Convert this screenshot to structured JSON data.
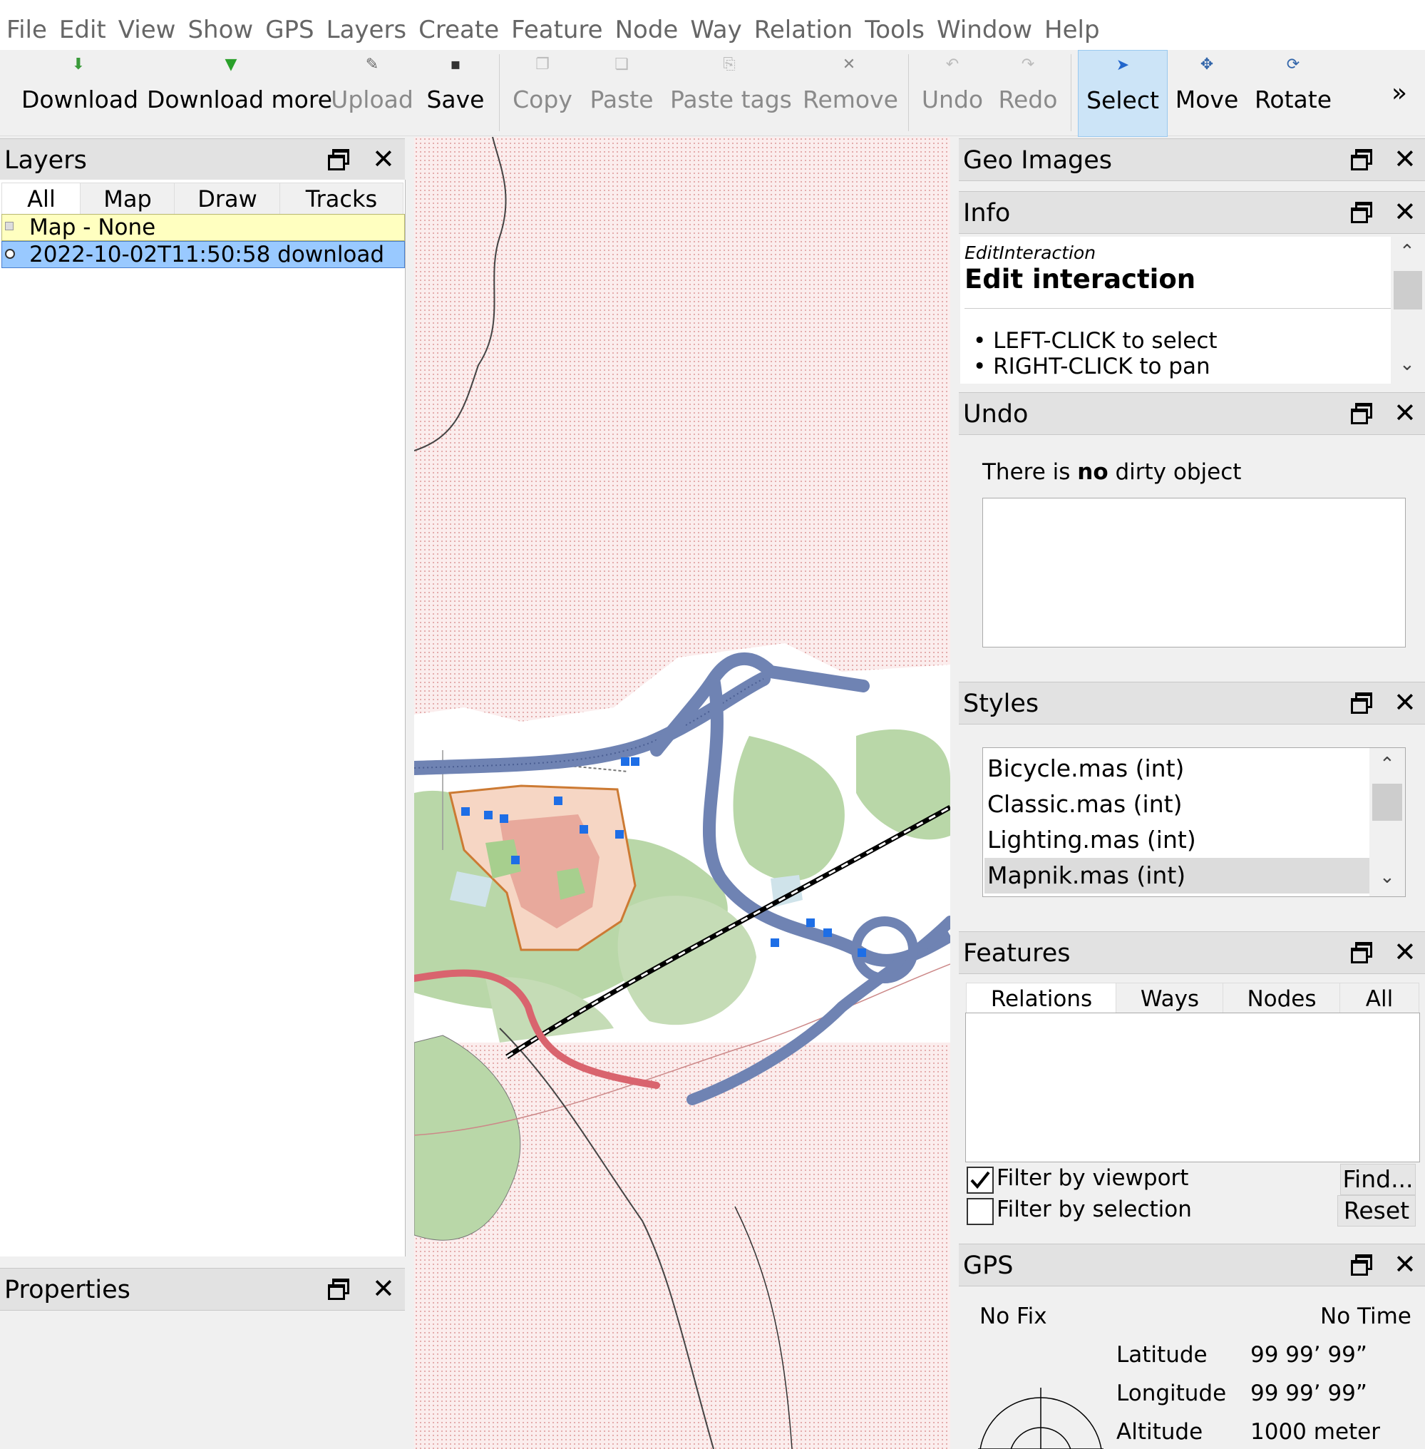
{
  "menu": [
    "File",
    "Edit",
    "View",
    "Show",
    "GPS",
    "Layers",
    "Create",
    "Feature",
    "Node",
    "Way",
    "Relation",
    "Tools",
    "Window",
    "Help"
  ],
  "toolbar": {
    "download": "Download",
    "download_more": "Download more",
    "upload": "Upload",
    "save": "Save",
    "copy": "Copy",
    "paste": "Paste",
    "paste_tags": "Paste tags",
    "remove": "Remove",
    "undo": "Undo",
    "redo": "Redo",
    "select": "Select",
    "move": "Move",
    "rotate": "Rotate",
    "overflow": "»"
  },
  "layers": {
    "title": "Layers",
    "tabs": [
      "All",
      "Map",
      "Draw",
      "Tracks"
    ],
    "items": [
      "Map - None",
      "2022-10-02T11:50:58 download"
    ]
  },
  "properties": {
    "title": "Properties"
  },
  "geo_images": {
    "title": "Geo Images"
  },
  "info": {
    "title": "Info",
    "subtitle": "EditInteraction",
    "heading": "Edit interaction",
    "bullets": [
      "LEFT-CLICK to select",
      "RIGHT-CLICK to pan"
    ]
  },
  "undo_panel": {
    "title": "Undo",
    "message_pre": "There is ",
    "message_bold": "no",
    "message_post": " dirty object"
  },
  "styles": {
    "title": "Styles",
    "items": [
      "Bicycle.mas (int)",
      "Classic.mas (int)",
      "Lighting.mas (int)",
      "Mapnik.mas (int)"
    ],
    "selected_index": 3
  },
  "features": {
    "title": "Features",
    "tabs": [
      "Relations",
      "Ways",
      "Nodes",
      "All"
    ],
    "filter_viewport": "Filter by viewport",
    "filter_viewport_checked": true,
    "filter_selection": "Filter by selection",
    "filter_selection_checked": false,
    "find_button": "Find...",
    "reset_button": "Reset"
  },
  "gps": {
    "title": "GPS",
    "fix": "No Fix",
    "time": "No Time",
    "latitude_label": "Latitude",
    "latitude_value": "99 99’ 99”",
    "longitude_label": "Longitude",
    "longitude_value": "99 99’ 99”",
    "altitude_label": "Altitude",
    "altitude_value": "1000 meter"
  },
  "colors": {
    "selection_blue": "#99c9ff",
    "map_none_yellow": "#ffffc0",
    "motorway": "#6f83b3",
    "trunk": "#d9646e",
    "forest": "#b9d7a8",
    "residential": "#e8a99c",
    "outside_bg": "#fbeded"
  }
}
